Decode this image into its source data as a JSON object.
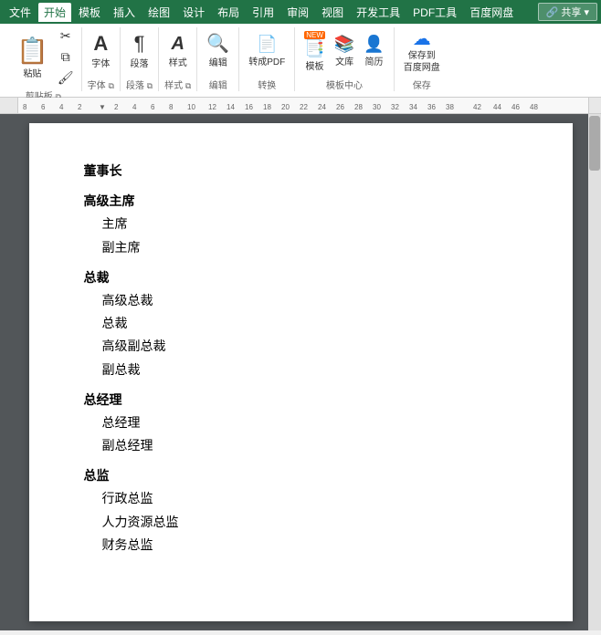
{
  "menubar": {
    "items": [
      "文件",
      "开始",
      "模板",
      "插入",
      "绘图",
      "设计",
      "布局",
      "引用",
      "审阅",
      "视图",
      "开发工具",
      "PDF工具",
      "百度网盘"
    ],
    "active": "开始",
    "share": "🔗 共享 ▾"
  },
  "toolbar": {
    "groups": [
      {
        "label": "剪贴板",
        "buttons": [
          {
            "id": "paste",
            "icon": "📋",
            "label": "粘贴"
          },
          {
            "id": "cut",
            "icon": "✂",
            "label": ""
          },
          {
            "id": "copy",
            "icon": "📄",
            "label": ""
          },
          {
            "id": "format-painter",
            "icon": "🖌",
            "label": ""
          }
        ]
      },
      {
        "label": "字体",
        "buttons": [
          {
            "id": "font",
            "icon": "A",
            "label": "字体"
          }
        ]
      },
      {
        "label": "段落",
        "buttons": [
          {
            "id": "paragraph",
            "icon": "¶",
            "label": "段落"
          }
        ]
      },
      {
        "label": "样式",
        "buttons": [
          {
            "id": "style",
            "icon": "A",
            "label": "样式"
          }
        ]
      },
      {
        "label": "编辑",
        "buttons": [
          {
            "id": "edit",
            "icon": "🔍",
            "label": "编辑"
          }
        ]
      },
      {
        "label": "转换",
        "buttons": [
          {
            "id": "to-pdf",
            "icon": "📄",
            "label": "转成PDF"
          }
        ]
      },
      {
        "label": "模板中心",
        "buttons": [
          {
            "id": "template",
            "icon": "📑",
            "label": "模板"
          },
          {
            "id": "library",
            "icon": "📚",
            "label": "文库"
          },
          {
            "id": "resume",
            "icon": "👤",
            "label": "简历"
          }
        ]
      },
      {
        "label": "保存",
        "buttons": [
          {
            "id": "save-cloud",
            "icon": "☁",
            "label": "保存到\n百度网盘"
          }
        ]
      }
    ]
  },
  "document": {
    "content": [
      {
        "type": "heading",
        "text": "董事长"
      },
      {
        "type": "heading",
        "text": "高级主席"
      },
      {
        "type": "subitem",
        "text": "主席"
      },
      {
        "type": "subitem",
        "text": "副主席"
      },
      {
        "type": "heading",
        "text": "总裁"
      },
      {
        "type": "subitem",
        "text": "高级总裁"
      },
      {
        "type": "subitem",
        "text": "总裁"
      },
      {
        "type": "subitem",
        "text": "高级副总裁"
      },
      {
        "type": "subitem",
        "text": "副总裁"
      },
      {
        "type": "heading",
        "text": "总经理"
      },
      {
        "type": "subitem",
        "text": "总经理"
      },
      {
        "type": "subitem",
        "text": "副总经理"
      },
      {
        "type": "heading",
        "text": "总监"
      },
      {
        "type": "subitem",
        "text": "行政总监"
      },
      {
        "type": "subitem",
        "text": "人力资源总监"
      },
      {
        "type": "subitem",
        "text": "财务总监"
      }
    ]
  }
}
